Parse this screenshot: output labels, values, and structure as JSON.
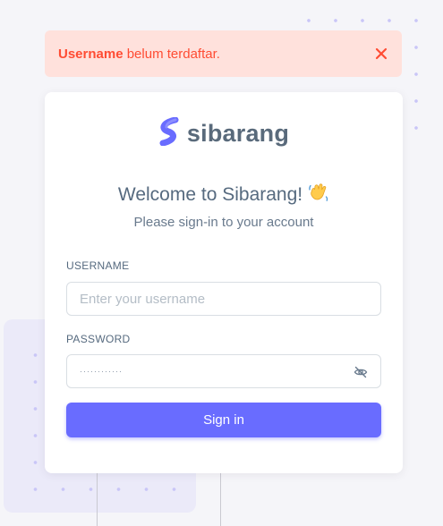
{
  "alert": {
    "strong_text": "Username",
    "message": " belum terdaftar.",
    "close_icon": "close-icon",
    "color": "#ff4c33",
    "background": "#ffe1dc"
  },
  "brand": {
    "name": "sibarang",
    "logo_icon": "s-logo-icon",
    "logo_color": "#696cff"
  },
  "welcome": {
    "title": "Welcome to Sibarang!",
    "emoji_icon": "waving-hand-icon",
    "subtitle": "Please sign-in to your account"
  },
  "form": {
    "username_label": "USERNAME",
    "username_placeholder": "Enter your username",
    "username_value": "",
    "password_label": "PASSWORD",
    "password_value": "············",
    "password_toggle_icon": "eye-off-icon",
    "submit_label": "Sign in",
    "accent_color": "#696cff"
  }
}
